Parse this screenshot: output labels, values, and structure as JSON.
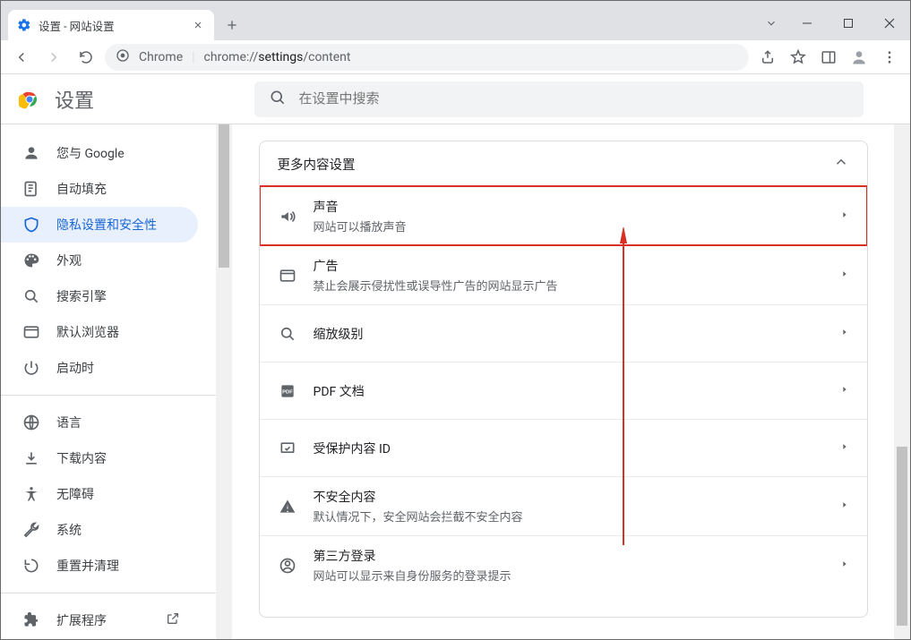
{
  "window": {
    "tab_title": "设置 - 网站设置"
  },
  "omnibox": {
    "origin_label": "Chrome",
    "url_host": "chrome://",
    "url_path1": "settings",
    "url_path2": "/content"
  },
  "header": {
    "title": "设置",
    "search_placeholder": "在设置中搜索"
  },
  "sidebar": {
    "items": [
      {
        "icon": "person",
        "label": "您与 Google"
      },
      {
        "icon": "autofill",
        "label": "自动填充"
      },
      {
        "icon": "shield",
        "label": "隐私设置和安全性",
        "selected": true
      },
      {
        "icon": "palette",
        "label": "外观"
      },
      {
        "icon": "search",
        "label": "搜索引擎"
      },
      {
        "icon": "browser",
        "label": "默认浏览器"
      },
      {
        "icon": "power",
        "label": "启动时"
      }
    ],
    "items2": [
      {
        "icon": "globe",
        "label": "语言"
      },
      {
        "icon": "download",
        "label": "下载内容"
      },
      {
        "icon": "accessibility",
        "label": "无障碍"
      },
      {
        "icon": "wrench",
        "label": "系统"
      },
      {
        "icon": "reset",
        "label": "重置并清理"
      }
    ],
    "items3": [
      {
        "icon": "extension",
        "label": "扩展程序",
        "external": true
      }
    ]
  },
  "content": {
    "section_title": "更多内容设置",
    "rows": [
      {
        "icon": "sound",
        "title": "声音",
        "sub": "网站可以播放声音",
        "highlight": true
      },
      {
        "icon": "ad",
        "title": "广告",
        "sub": "禁止会展示侵扰性或误导性广告的网站显示广告"
      },
      {
        "icon": "zoom",
        "title": "缩放级别",
        "sub": ""
      },
      {
        "icon": "pdf",
        "title": "PDF 文档",
        "sub": ""
      },
      {
        "icon": "protected",
        "title": "受保护内容 ID",
        "sub": ""
      },
      {
        "icon": "warning",
        "title": "不安全内容",
        "sub": "默认情况下，安全网站会拦截不安全内容"
      },
      {
        "icon": "login",
        "title": "第三方登录",
        "sub": "网站可以显示来自身份服务的登录提示"
      }
    ]
  }
}
